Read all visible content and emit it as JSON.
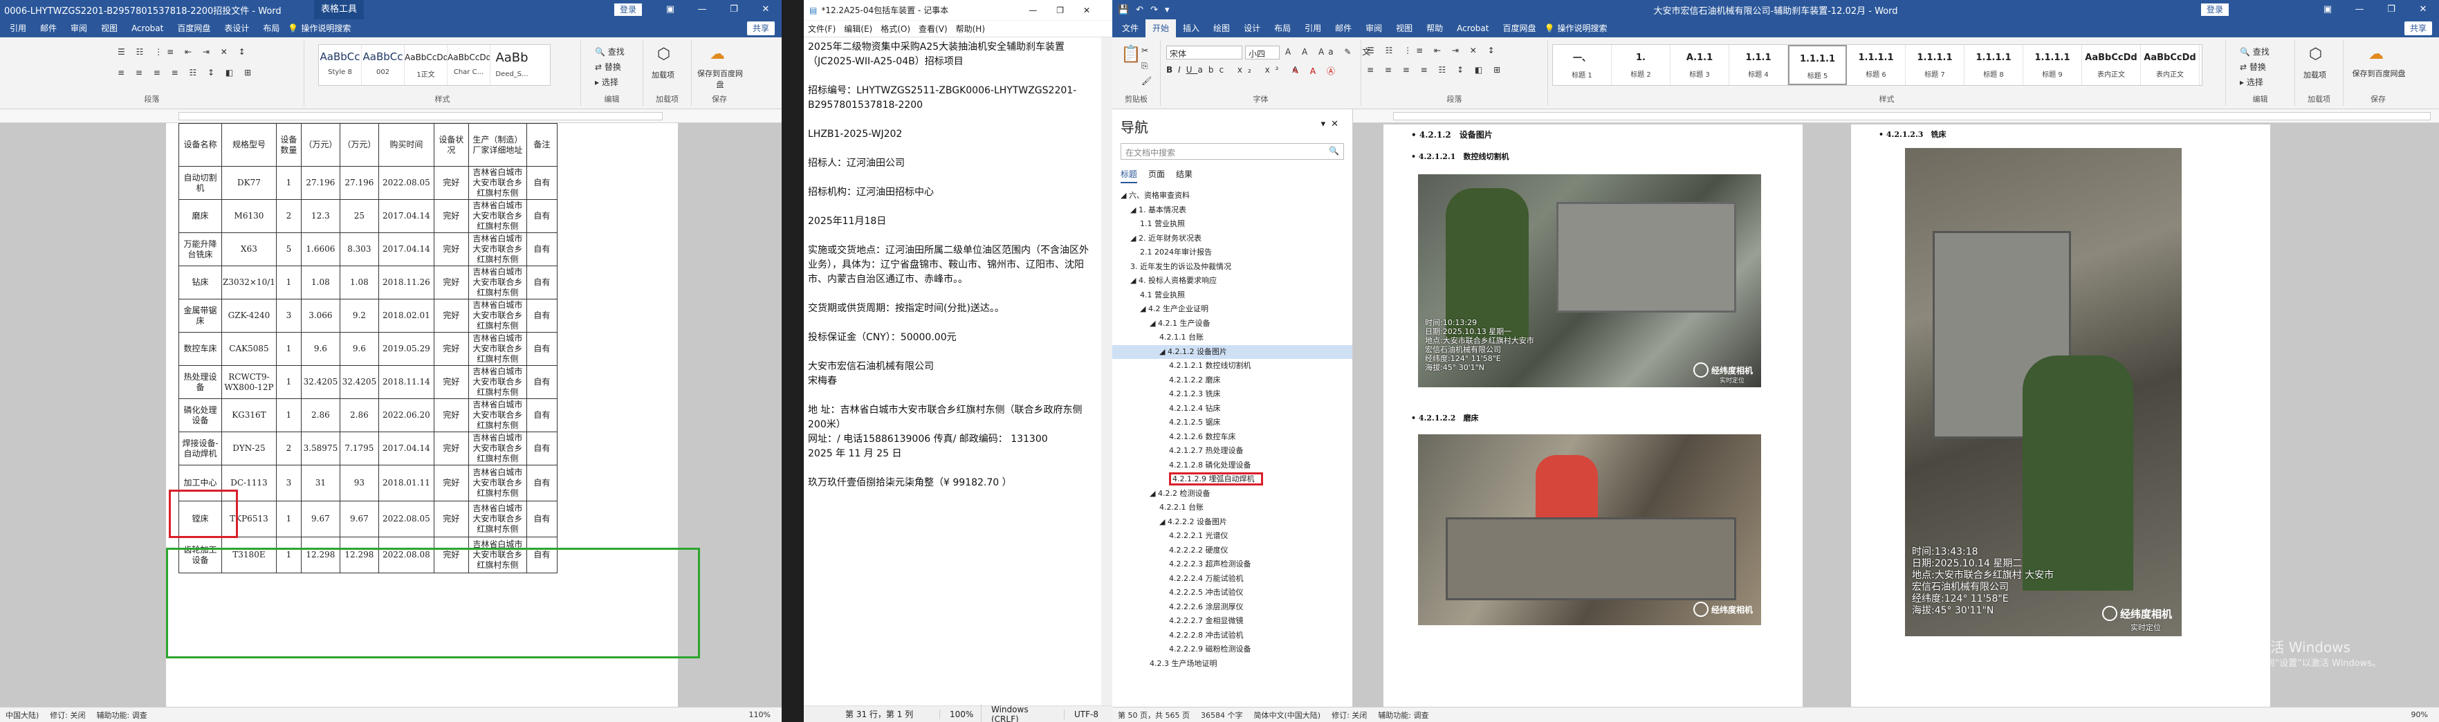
{
  "word1": {
    "title": "0006-LHYTWZGS2201-B2957801537818-2200招投文件 - Word",
    "table_tools": "表格工具",
    "login": "登录",
    "tabs": [
      "引用",
      "邮件",
      "审阅",
      "视图",
      "Acrobat",
      "百度网盘",
      "表设计",
      "布局"
    ],
    "tell_me": "操作说明搜索",
    "share": "共享",
    "ribbon_groups": [
      "段落",
      "样式",
      "编辑",
      "加载项",
      "保存"
    ],
    "styles": [
      {
        "preview": "AaBbCc",
        "name": "Style 8"
      },
      {
        "preview": "AaBbCc",
        "name": "002"
      },
      {
        "preview": "AaBbCcDd",
        "name": "1正文"
      },
      {
        "preview": "AaBbCcDd",
        "name": "Char C..."
      },
      {
        "preview": "AaBb",
        "name": "Deed_S..."
      }
    ],
    "edit_buttons": [
      "查找",
      "替换",
      "选择"
    ],
    "addin_buttons": [
      "加载项",
      "保存到百度网盘"
    ],
    "table": {
      "header": [
        "设备名称",
        "规格型号",
        "设备数量",
        "（万元）",
        "（万元）",
        "购买时间",
        "设备状况",
        "生产（制造）厂家详细地址",
        "备注"
      ],
      "rows": [
        [
          "自动切割机",
          "DK77",
          "1",
          "27.196",
          "27.196",
          "2022.08.05",
          "完好",
          "吉林省白城市大安市联合乡红旗村东侧",
          "自有"
        ],
        [
          "磨床",
          "M6130",
          "2",
          "12.3",
          "25",
          "2017.04.14",
          "完好",
          "吉林省白城市大安市联合乡红旗村东侧",
          "自有"
        ],
        [
          "万能升降台铣床",
          "X63",
          "5",
          "1.6606",
          "8.303",
          "2017.04.14",
          "完好",
          "吉林省白城市大安市联合乡红旗村东侧",
          "自有"
        ],
        [
          "钻床",
          "Z3032×10/1",
          "1",
          "1.08",
          "1.08",
          "2018.11.26",
          "完好",
          "吉林省白城市大安市联合乡红旗村东侧",
          "自有"
        ],
        [
          "金属带锯床",
          "GZK-4240",
          "3",
          "3.066",
          "9.2",
          "2018.02.01",
          "完好",
          "吉林省白城市大安市联合乡红旗村东侧",
          "自有"
        ],
        [
          "数控车床",
          "CAK5085",
          "1",
          "9.6",
          "9.6",
          "2019.05.29",
          "完好",
          "吉林省白城市大安市联合乡红旗村东侧",
          "自有"
        ],
        [
          "热处理设备",
          "RCWCT9-WX800-12P",
          "1",
          "32.4205",
          "32.4205",
          "2018.11.14",
          "完好",
          "吉林省白城市大安市联合乡红旗村东侧",
          "自有"
        ],
        [
          "磷化处理设备",
          "KG316T",
          "1",
          "2.86",
          "2.86",
          "2022.06.20",
          "完好",
          "吉林省白城市大安市联合乡红旗村东侧",
          "自有"
        ],
        [
          "焊接设备-自动焊机",
          "DYN-25",
          "2",
          "3.58975",
          "7.1795",
          "2017.04.14",
          "完好",
          "吉林省白城市大安市联合乡红旗村东侧",
          "自有"
        ],
        [
          "加工中心",
          "DC-1113",
          "3",
          "31",
          "93",
          "2018.01.11",
          "完好",
          "吉林省白城市大安市联合乡红旗村东侧",
          "自有"
        ],
        [
          "镗床",
          "TKP6513",
          "1",
          "9.67",
          "9.67",
          "2022.08.05",
          "完好",
          "吉林省白城市大安市联合乡红旗村东侧",
          "自有"
        ],
        [
          "齿轮加工设备",
          "T3180E",
          "1",
          "12.298",
          "12.298",
          "2022.08.08",
          "完好",
          "吉林省白城市大安市联合乡红旗村东侧",
          "自有"
        ]
      ]
    },
    "status": [
      "中国大陆)",
      "修订: 关闭",
      "辅助功能: 调查"
    ],
    "zoom": "110%"
  },
  "notepad": {
    "title": "*12.2A25-04包括车装置 - 记事本",
    "menu": [
      "文件(F)",
      "编辑(E)",
      "格式(O)",
      "查看(V)",
      "帮助(H)"
    ],
    "content": "2025年二级物资集中采购A25大装抽油机安全辅助刹车装置（JC2025-WII-A25-04B）招标项目\n\n招标编号：LHYTWZGS2511-ZBGK0006-LHYTWZGS2201-B2957801537818-2200\n\nLHZB1-2025-WJ202\n\n招标人：辽河油田公司\n\n招标机构：辽河油田招标中心\n\n2025年11月18日\n\n实施或交货地点：辽河油田所属二级单位油区范围内（不含油区外业务），具体为：辽宁省盘锦市、鞍山市、锦州市、辽阳市、沈阳市、内蒙古自治区通辽市、赤峰市。。\n\n交货期或供货周期：按指定时间(分批)送达。。\n\n投标保证金（CNY）：50000.00元\n\n大安市宏信石油机械有限公司\n宋梅春\n\n地 址：吉林省白城市大安市联合乡红旗村东侧（联合乡政府东侧200米）\n网址：/ 电话15886139006 传真/ 邮政编码： 131300\n2025 年 11 月 25 日\n\n玖万玖仟壹佰捌拾柒元柒角整（¥ 99182.70 ）",
    "status": [
      "第 31 行，第 1 列",
      "100%",
      "Windows (CRLF)",
      "UTF-8"
    ]
  },
  "word2": {
    "title": "大安市宏信石油机械有限公司-辅助刹车装置-12.02月 - Word",
    "login": "登录",
    "tabs": [
      "文件",
      "开始",
      "插入",
      "绘图",
      "设计",
      "布局",
      "引用",
      "邮件",
      "审阅",
      "视图",
      "帮助",
      "Acrobat",
      "百度网盘"
    ],
    "active_tab": "开始",
    "tell_me": "操作说明搜索",
    "share": "共享",
    "font_name": "宋体",
    "font_size": "小四",
    "ribbon_groups": [
      "剪贴板",
      "字体",
      "段落",
      "样式",
      "编辑",
      "加载项",
      "保存"
    ],
    "styles": [
      {
        "preview": "一、",
        "name": "标题 1"
      },
      {
        "preview": "1.",
        "name": "标题 2"
      },
      {
        "preview": "A.1.1",
        "name": "标题 3"
      },
      {
        "preview": "1.1.1",
        "name": "标题 4"
      },
      {
        "preview": "1.1.1.1",
        "name": "标题 5"
      },
      {
        "preview": "1.1.1.1",
        "name": "标题 6"
      },
      {
        "preview": "1.1.1.1",
        "name": "标题 7"
      },
      {
        "preview": "1.1.1.1",
        "name": "标题 8"
      },
      {
        "preview": "1.1.1.1",
        "name": "标题 9"
      },
      {
        "preview": "AaBbCcDd",
        "name": "表内正文"
      },
      {
        "preview": "AaBbCcDd",
        "name": "表内正文"
      }
    ],
    "nav": {
      "title": "导航",
      "search_placeholder": "在文档中搜索",
      "tabs": [
        "标题",
        "页面",
        "结果"
      ],
      "items": [
        {
          "text": "◢ 六、资格审查资料",
          "level": 0
        },
        {
          "text": "◢ 1. 基本情况表",
          "level": 1
        },
        {
          "text": "1.1 营业执照",
          "level": 2
        },
        {
          "text": "◢ 2. 近年财务状况表",
          "level": 1
        },
        {
          "text": "2.1 2024年审计报告",
          "level": 2
        },
        {
          "text": "3. 近年发生的诉讼及仲裁情况",
          "level": 1
        },
        {
          "text": "◢ 4. 投标人资格要求响应",
          "level": 1
        },
        {
          "text": "4.1 营业执照",
          "level": 2
        },
        {
          "text": "◢ 4.2 生产企业证明",
          "level": 2
        },
        {
          "text": "◢ 4.2.1 生产设备",
          "level": 3
        },
        {
          "text": "4.2.1.1 台账",
          "level": 4
        },
        {
          "text": "◢ 4.2.1.2 设备图片",
          "level": 4,
          "selected": true
        },
        {
          "text": "4.2.1.2.1 数控线切割机",
          "level": 5
        },
        {
          "text": "4.2.1.2.2 磨床",
          "level": 5
        },
        {
          "text": "4.2.1.2.3 铣床",
          "level": 5
        },
        {
          "text": "4.2.1.2.4 钻床",
          "level": 5
        },
        {
          "text": "4.2.1.2.5 锯床",
          "level": 5
        },
        {
          "text": "4.2.1.2.6 数控车床",
          "level": 5
        },
        {
          "text": "4.2.1.2.7 热处理设备",
          "level": 5
        },
        {
          "text": "4.2.1.2.8 磷化处理设备",
          "level": 5
        },
        {
          "text": "4.2.1.2.9 埋弧自动焊机",
          "level": 5,
          "boxed": true
        },
        {
          "text": "◢ 4.2.2 检测设备",
          "level": 3
        },
        {
          "text": "4.2.2.1 台账",
          "level": 4
        },
        {
          "text": "◢ 4.2.2.2 设备图片",
          "level": 4
        },
        {
          "text": "4.2.2.2.1 光谱仪",
          "level": 5
        },
        {
          "text": "4.2.2.2.2 硬度仪",
          "level": 5
        },
        {
          "text": "4.2.2.2.3 超声检测设备",
          "level": 5
        },
        {
          "text": "4.2.2.2.4 万能试验机",
          "level": 5
        },
        {
          "text": "4.2.2.2.5 冲击试验仪",
          "level": 5
        },
        {
          "text": "4.2.2.2.6 涂层测厚仪",
          "level": 5
        },
        {
          "text": "4.2.2.2.7 金相显微镜",
          "level": 5
        },
        {
          "text": "4.2.2.2.8 冲击试验机",
          "level": 5
        },
        {
          "text": "4.2.2.2.9 磁粉检测设备",
          "level": 5
        },
        {
          "text": "4.2.3 生产场地证明",
          "level": 3
        }
      ]
    },
    "doc": {
      "h_main": "• 4.2.1.2　设备图片",
      "cap1": "• 4.2.1.2.1　数控线切割机",
      "cap2": "• 4.2.1.2.2　磨床",
      "cap3": "• 4.2.1.2.3　铣床",
      "wm1": [
        "时间:10:13:29",
        "日期:2025.10.13 星期一",
        "地点:大安市联合乡红旗村大安市",
        "宏信石油机械有限公司",
        "经纬度:124° 11'58\"E",
        "海拔:45° 30'1\"N"
      ],
      "wm3": [
        "时间:13:43:18",
        "日期:2025.10.14 星期二",
        "地点:大安市联合乡红旗村 大安市",
        "宏信石油机械有限公司",
        "经纬度:124° 11'58\"E",
        "海拔:45° 30'11\"N"
      ],
      "logo": "经纬度相机",
      "logo_sub": "实时定位"
    },
    "status": [
      "第 50 页，共 565 页",
      "36584 个字",
      "简体中文(中国大陆)",
      "修订: 关闭",
      "辅助功能: 调查"
    ],
    "zoom": "90%",
    "activate": "激活 Windows",
    "activate_sub": "转到“设置”以激活 Windows。"
  }
}
